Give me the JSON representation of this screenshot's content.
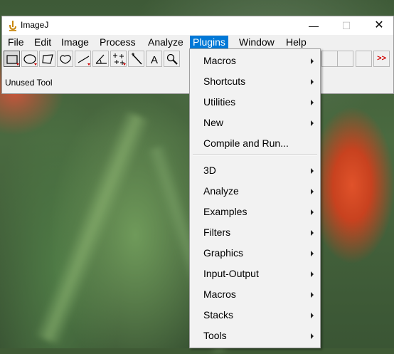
{
  "window": {
    "title": "ImageJ",
    "controls": {
      "minimize": "—",
      "maximize": "☐",
      "close": "✕"
    }
  },
  "menubar": {
    "items": [
      "File",
      "Edit",
      "Image",
      "Process",
      "Analyze",
      "Plugins",
      "Window",
      "Help"
    ],
    "active": "Plugins"
  },
  "toolbar": {
    "tools": [
      "rectangle-tool",
      "oval-tool",
      "polygon-tool",
      "freehand-tool",
      "straight-line-tool",
      "angle-tool",
      "multi-point-tool",
      "wand-tool",
      "text-tool",
      "magnifying-glass-tool"
    ],
    "text_tool_label": "A",
    "more_tools_label": ">>"
  },
  "status": {
    "text": "Unused Tool"
  },
  "plugins_menu": {
    "group1": [
      {
        "label": "Macros",
        "submenu": true
      },
      {
        "label": "Shortcuts",
        "submenu": true
      },
      {
        "label": "Utilities",
        "submenu": true
      },
      {
        "label": "New",
        "submenu": true
      },
      {
        "label": "Compile and Run...",
        "submenu": false
      }
    ],
    "group2": [
      {
        "label": "3D",
        "submenu": true
      },
      {
        "label": "Analyze",
        "submenu": true
      },
      {
        "label": "Examples",
        "submenu": true
      },
      {
        "label": "Filters",
        "submenu": true
      },
      {
        "label": "Graphics",
        "submenu": true
      },
      {
        "label": "Input-Output",
        "submenu": true
      },
      {
        "label": "Macros",
        "submenu": true
      },
      {
        "label": "Stacks",
        "submenu": true
      },
      {
        "label": "Tools",
        "submenu": true
      }
    ]
  },
  "colors": {
    "menu_highlight": "#0078d7",
    "more_tools_arrow": "#d00000"
  }
}
